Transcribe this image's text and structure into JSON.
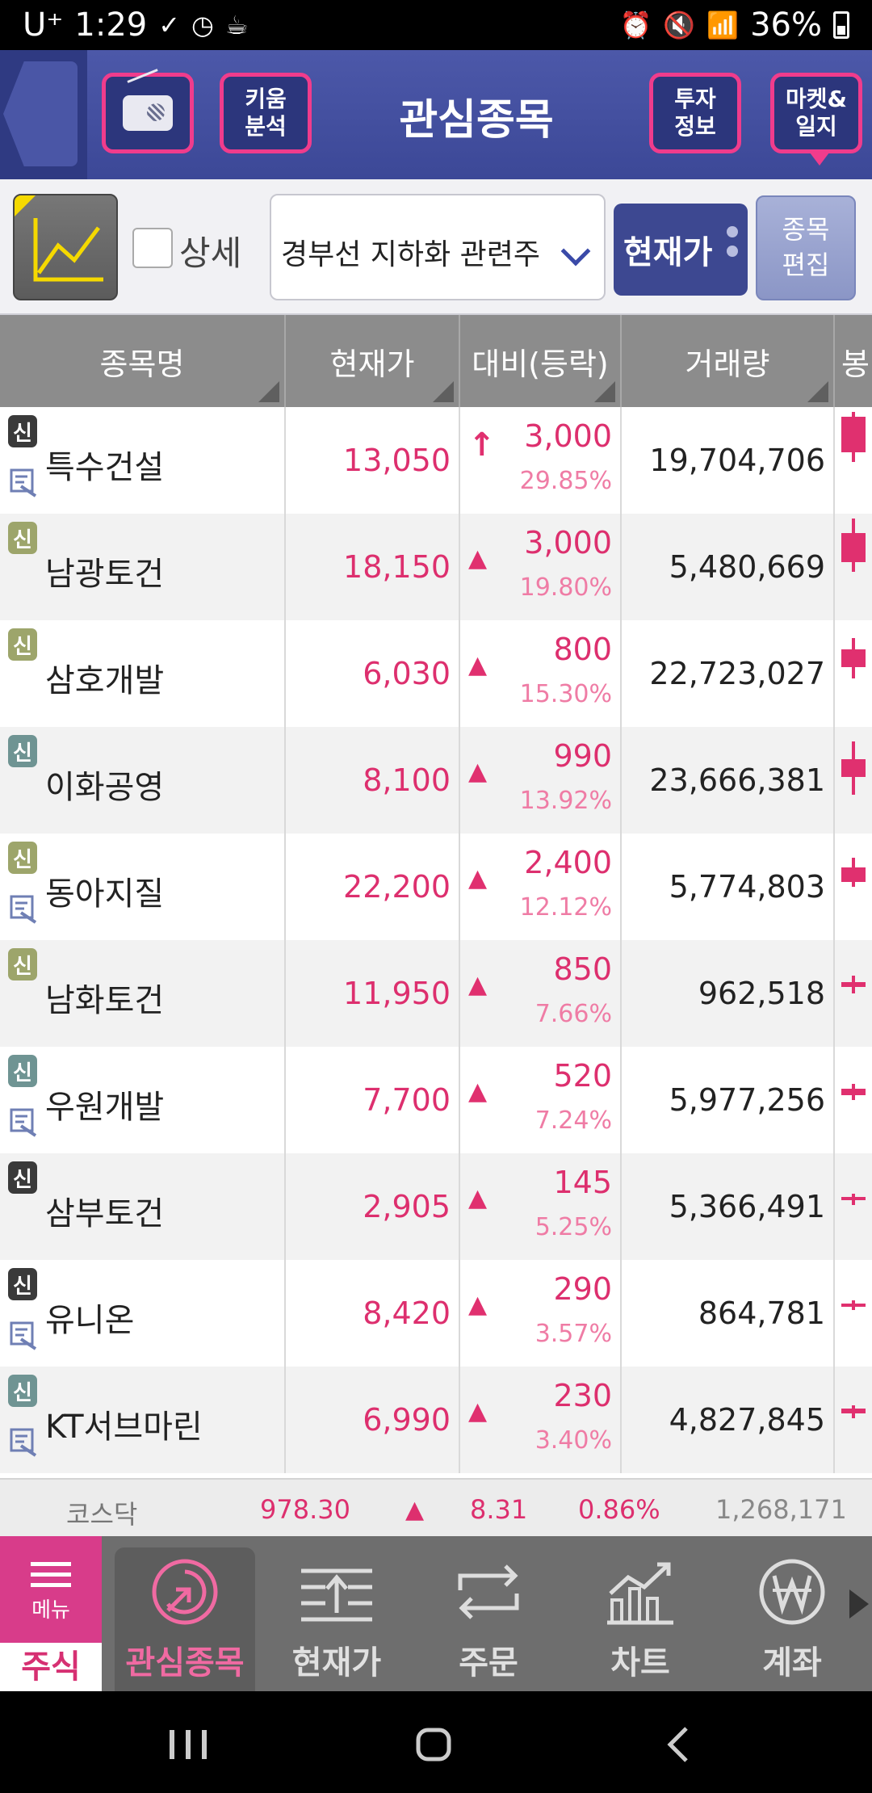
{
  "status_bar": {
    "carrier": "U⁺",
    "time": "1:29",
    "battery": "36%"
  },
  "header": {
    "title": "관심종목",
    "kiwoom_button": "키움\n분석",
    "invest_button": "투자\n정보",
    "market_button": "마켓&\n일지"
  },
  "controls": {
    "detail_label": "상세",
    "group_name": "경부선 지하화 관련주",
    "price_button": "현재가",
    "edit_button": "종목\n편집"
  },
  "columns": [
    "종목명",
    "현재가",
    "대비(등락)",
    "거래량",
    "봉"
  ],
  "rows": [
    {
      "badge": "신",
      "badge_color": "black",
      "memo": true,
      "name": "특수건설",
      "price": "13,050",
      "arrow": "up-bold",
      "change": "3,000",
      "pct": "29.85%",
      "volume": "19,704,706"
    },
    {
      "badge": "신",
      "badge_color": "olive",
      "memo": false,
      "name": "남광토건",
      "price": "18,150",
      "arrow": "up",
      "change": "3,000",
      "pct": "19.80%",
      "volume": "5,480,669"
    },
    {
      "badge": "신",
      "badge_color": "olive",
      "memo": false,
      "name": "삼호개발",
      "price": "6,030",
      "arrow": "up",
      "change": "800",
      "pct": "15.30%",
      "volume": "22,723,027"
    },
    {
      "badge": "신",
      "badge_color": "teal",
      "memo": false,
      "name": "이화공영",
      "price": "8,100",
      "arrow": "up",
      "change": "990",
      "pct": "13.92%",
      "volume": "23,666,381"
    },
    {
      "badge": "신",
      "badge_color": "olive",
      "memo": true,
      "name": "동아지질",
      "price": "22,200",
      "arrow": "up",
      "change": "2,400",
      "pct": "12.12%",
      "volume": "5,774,803"
    },
    {
      "badge": "신",
      "badge_color": "olive",
      "memo": false,
      "name": "남화토건",
      "price": "11,950",
      "arrow": "up",
      "change": "850",
      "pct": "7.66%",
      "volume": "962,518"
    },
    {
      "badge": "신",
      "badge_color": "teal",
      "memo": true,
      "name": "우원개발",
      "price": "7,700",
      "arrow": "up",
      "change": "520",
      "pct": "7.24%",
      "volume": "5,977,256"
    },
    {
      "badge": "신",
      "badge_color": "black",
      "memo": false,
      "name": "삼부토건",
      "price": "2,905",
      "arrow": "up",
      "change": "145",
      "pct": "5.25%",
      "volume": "5,366,491"
    },
    {
      "badge": "신",
      "badge_color": "black",
      "memo": true,
      "name": "유니온",
      "price": "8,420",
      "arrow": "up",
      "change": "290",
      "pct": "3.57%",
      "volume": "864,781"
    },
    {
      "badge": "신",
      "badge_color": "teal",
      "memo": true,
      "name": "KT서브마린",
      "price": "6,990",
      "arrow": "up",
      "change": "230",
      "pct": "3.40%",
      "volume": "4,827,845"
    }
  ],
  "ticker": {
    "index_name": "코스닥",
    "value": "978.30",
    "change": "8.31",
    "pct": "0.86%",
    "volume": "1,268,171"
  },
  "bottom_nav": {
    "menu_label": "메뉴",
    "stock_tab": "주식",
    "items": [
      {
        "label": "관심종목",
        "icon": "watchlist-icon",
        "active": true
      },
      {
        "label": "현재가",
        "icon": "current-price-icon",
        "active": false
      },
      {
        "label": "주문",
        "icon": "order-icon",
        "active": false
      },
      {
        "label": "차트",
        "icon": "chart-icon",
        "active": false
      },
      {
        "label": "계좌",
        "icon": "account-won-icon",
        "active": false
      }
    ]
  },
  "colors": {
    "brand_navy": "#3c4897",
    "accent_pink": "#f03c8c",
    "up_red": "#dd2f6e"
  }
}
